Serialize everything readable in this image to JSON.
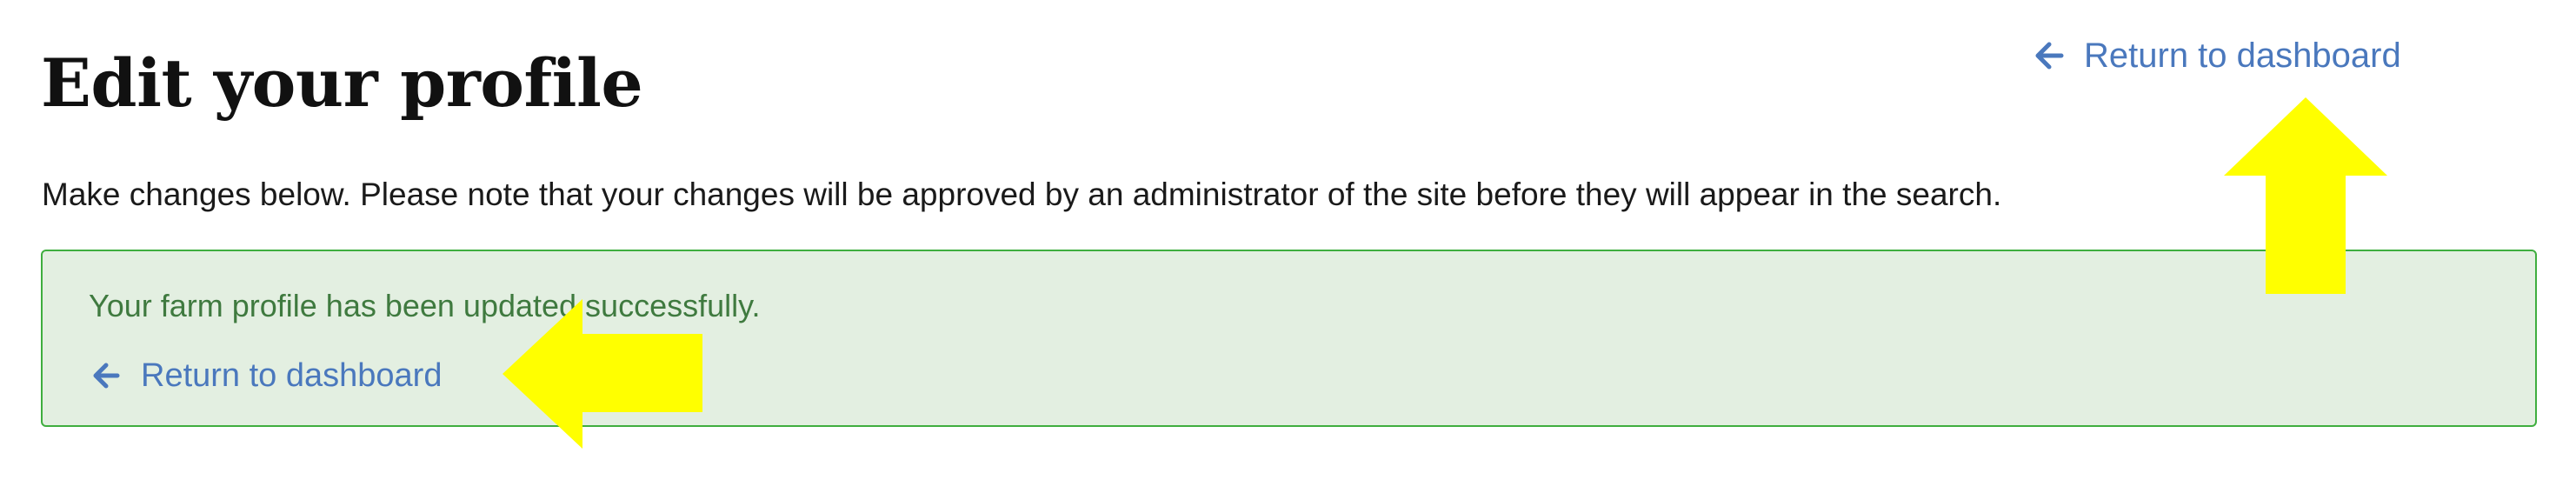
{
  "header": {
    "title": "Edit your profile",
    "return_link_label": "Return to dashboard",
    "return_icon": "arrow-left-icon"
  },
  "intro": {
    "text": "Make changes below. Please note that your changes will be approved by an administrator of the site before they will appear in the search."
  },
  "alert": {
    "message": "Your farm profile has been updated successfully.",
    "return_link_label": "Return to dashboard",
    "return_icon": "arrow-left-icon"
  },
  "annotations": {
    "arrow_up_icon": "up-arrow-annotation",
    "arrow_left_icon": "left-arrow-annotation"
  },
  "colors": {
    "link": "#4a78bd",
    "title": "#111111",
    "body_text": "#1a1a1a",
    "alert_background": "#e3efe1",
    "alert_border": "#3fae3f",
    "alert_text": "#3f7a3f",
    "annotation_arrow": "#ffff00"
  }
}
